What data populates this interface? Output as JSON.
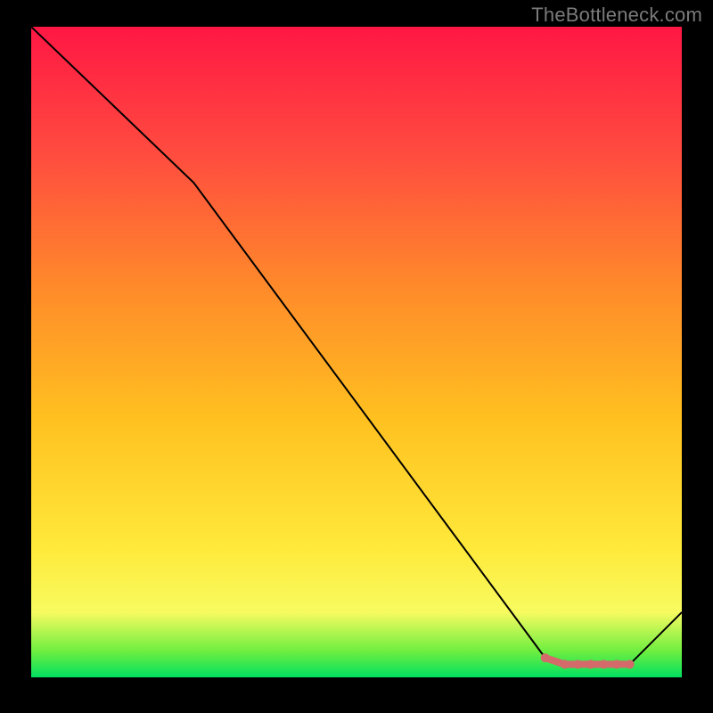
{
  "watermark": "TheBottleneck.com",
  "chart_data": {
    "type": "line",
    "title": "",
    "xlabel": "",
    "ylabel": "",
    "xlim": [
      0,
      100
    ],
    "ylim": [
      0,
      100
    ],
    "grid": false,
    "background_gradient": {
      "stops": [
        {
          "offset": 0,
          "color": "#00e060"
        },
        {
          "offset": 4,
          "color": "#6eee40"
        },
        {
          "offset": 10,
          "color": "#f7fb60"
        },
        {
          "offset": 20,
          "color": "#ffe93a"
        },
        {
          "offset": 40,
          "color": "#ffc020"
        },
        {
          "offset": 60,
          "color": "#ff8a2a"
        },
        {
          "offset": 80,
          "color": "#ff4d3f"
        },
        {
          "offset": 100,
          "color": "#ff1744"
        }
      ]
    },
    "series": [
      {
        "name": "bottleneck-curve",
        "color": "#000000",
        "x": [
          0,
          25,
          79,
          82,
          84,
          86,
          88,
          90,
          92,
          100
        ],
        "values": [
          100,
          76,
          3,
          2,
          2,
          2,
          2,
          2,
          2,
          10
        ]
      }
    ],
    "highlight": {
      "name": "optimal-range",
      "color": "#d46a6a",
      "x": [
        79,
        82,
        84,
        86,
        88,
        90,
        92
      ],
      "values": [
        3,
        2,
        2,
        2,
        2,
        2,
        2
      ]
    }
  }
}
